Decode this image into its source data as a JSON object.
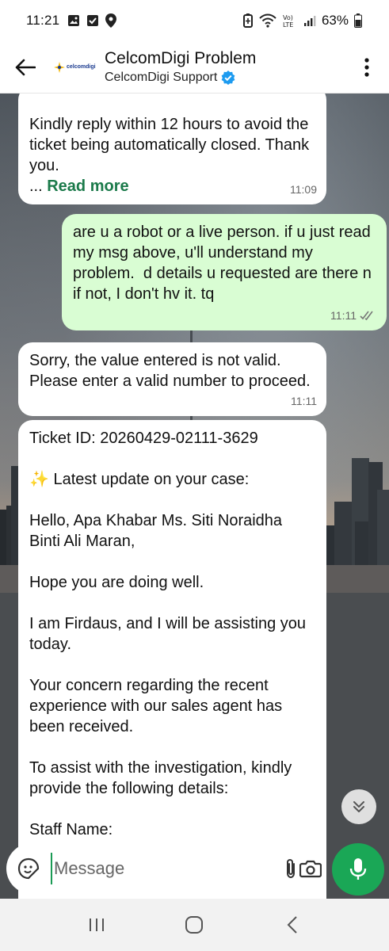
{
  "status_bar": {
    "time": "11:21",
    "battery_text": "63%",
    "icons": [
      "gallery-icon",
      "checkbox-icon",
      "location-icon",
      "battery-saver-icon",
      "wifi-icon",
      "volte-icon",
      "signal-icon",
      "battery-icon"
    ]
  },
  "header": {
    "title": "CelcomDigi Problem",
    "subtitle": "CelcomDigi Support",
    "logo_text": "celcomdigi",
    "verified": true
  },
  "messages": [
    {
      "direction": "in",
      "text": "Kindly reply within 12 hours to avoid the ticket being automatically closed. Thank you.",
      "ellipsis": "... ",
      "read_more": "Read more",
      "time": "11:09"
    },
    {
      "direction": "out",
      "text": "are u a robot or a live person. if u just read my msg above, u'll understand my problem.  d details u requested are there n if not, I don't hv it. tq",
      "time": "11:11",
      "status": "read"
    },
    {
      "direction": "in",
      "text": "Sorry, the value entered is not valid. Please enter a valid number to proceed.",
      "time": "11:11"
    },
    {
      "direction": "in",
      "text": "Ticket ID: 20260429-02111-3629\n\n✨ Latest update on your case:\n\nHello, Apa Khabar Ms. Siti Noraidha Binti Ali Maran,\n\nHope you are doing well.\n\nI am Firdaus, and I will be assisting you today.\n\nYour concern regarding the recent experience with our sales agent has been received.\n\nTo assist with the investigation, kindly provide the following details:\n\nStaff Name:"
    }
  ],
  "composer": {
    "placeholder": "Message"
  },
  "colors": {
    "accent_green": "#1aa756",
    "outgoing_bubble": "#d9fdd3",
    "read_more": "#1b7a4a",
    "verified_blue": "#1d9bf0"
  }
}
